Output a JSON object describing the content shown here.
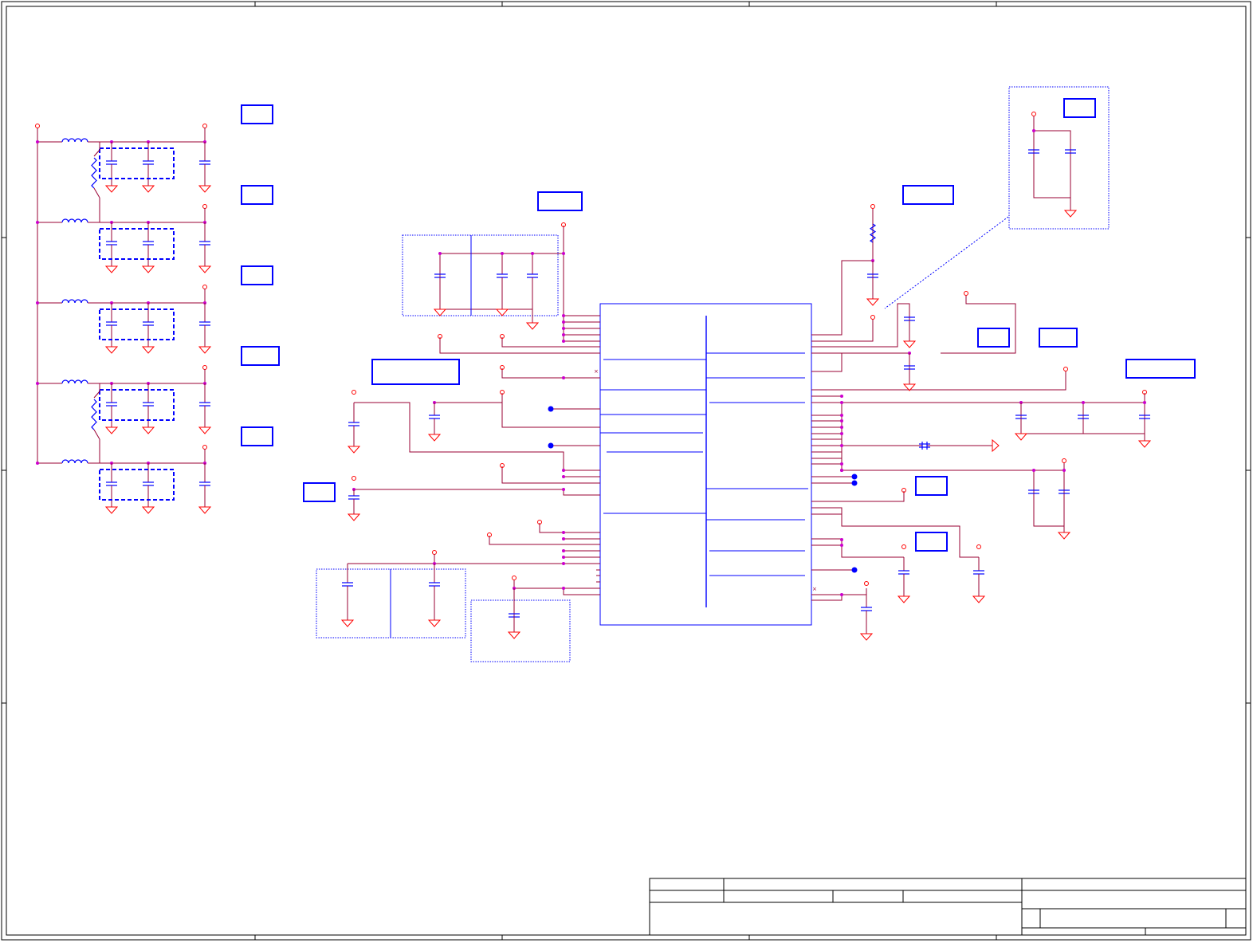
{
  "sheet": {
    "background": "#ffffff",
    "frame_color": "#000000",
    "component_color": "#0000ff",
    "wire_color": "#990033",
    "ground_color": "#ff0000",
    "junction_color": "#cc00cc"
  },
  "title_block": {
    "title": "",
    "sheet_number": "",
    "revision": ""
  }
}
